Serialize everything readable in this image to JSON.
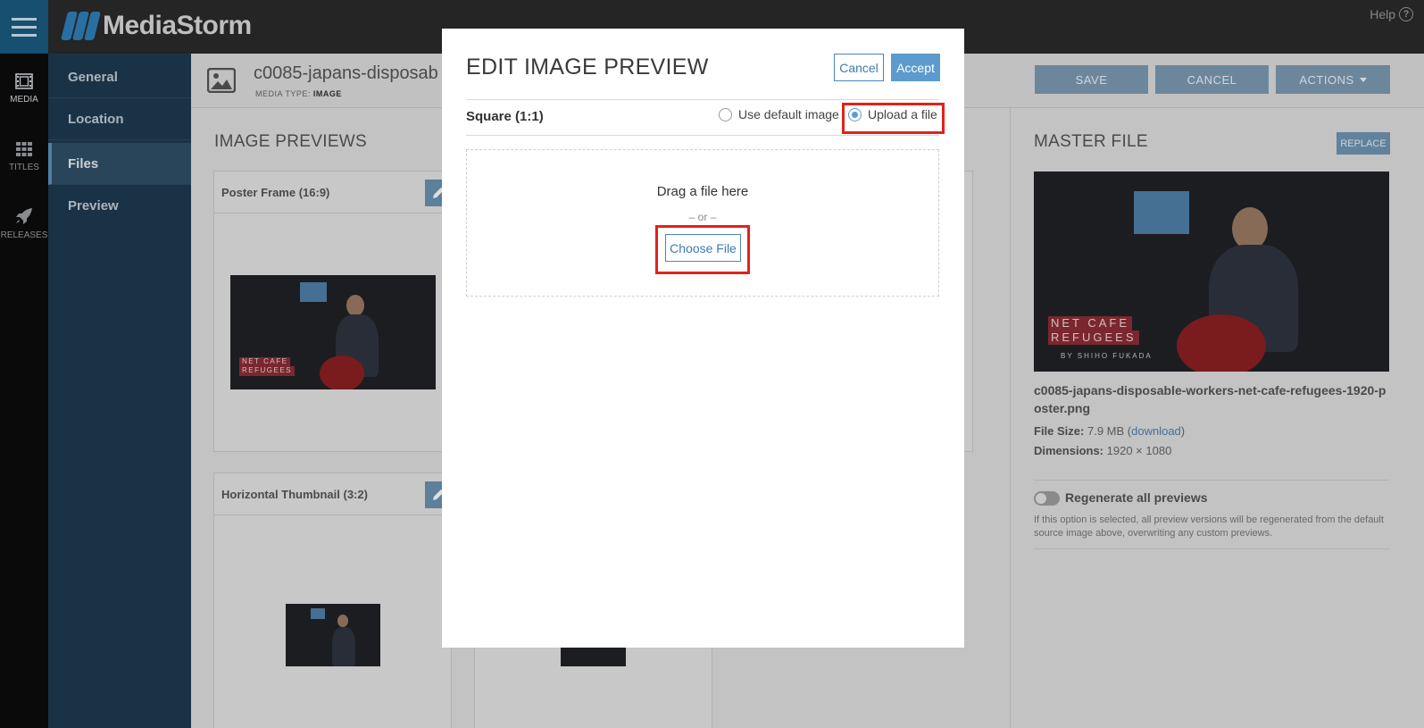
{
  "app": {
    "brand": "MediaStorm",
    "help_label": "Help"
  },
  "rail": [
    {
      "label": "MEDIA",
      "icon": "film-icon"
    },
    {
      "label": "TITLES",
      "icon": "grid-icon"
    },
    {
      "label": "RELEASES",
      "icon": "rocket-icon"
    }
  ],
  "subnav": [
    "General",
    "Location",
    "Files",
    "Preview"
  ],
  "page": {
    "title": "c0085-japans-disposab",
    "media_type_label": "MEDIA TYPE:",
    "media_type_value": "IMAGE",
    "buttons": {
      "save": "SAVE",
      "cancel": "CANCEL",
      "actions": "ACTIONS"
    }
  },
  "previews": {
    "heading": "IMAGE PREVIEWS",
    "cards": [
      "Poster Frame (16:9)",
      "Horizontal Thumbnail (3:2)"
    ],
    "thumb_tag_line1": "NET CAFE",
    "thumb_tag_line2": "REFUGEES",
    "thumb_byline": "BY SHIHO FUKADA"
  },
  "master": {
    "heading": "MASTER FILE",
    "replace": "REPLACE",
    "filename": "c0085-japans-disposable-workers-net-cafe-refugees-1920-poster.png",
    "file_size_label": "File Size:",
    "file_size_value": "7.9 MB",
    "download_label": "download",
    "dimensions_label": "Dimensions:",
    "dimensions_value": "1920 × 1080",
    "regen_label": "Regenerate all previews",
    "regen_help": "If this option is selected, all preview versions will be regenerated from the default source image above, overwriting any custom previews."
  },
  "modal": {
    "title": "EDIT IMAGE PREVIEW",
    "cancel": "Cancel",
    "accept": "Accept",
    "aspect_label": "Square (1:1)",
    "option_default": "Use default image",
    "option_upload": "Upload a file",
    "selected_option": "upload",
    "drag_text": "Drag a file here",
    "or_text": "– or –",
    "choose_file": "Choose File"
  },
  "colors": {
    "accent": "#5c9bcd",
    "highlight": "#e0231b",
    "nav_bg": "#1e3a4f"
  }
}
